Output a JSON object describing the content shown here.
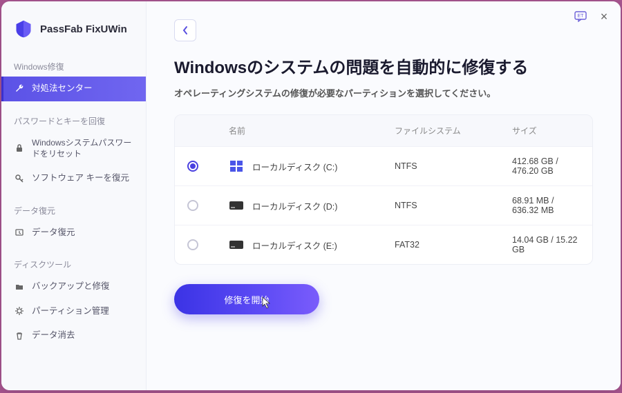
{
  "app": {
    "name": "PassFab FixUWin"
  },
  "sidebar": {
    "sections": [
      {
        "heading": "Windows修復",
        "items": [
          {
            "label": "対処法センター",
            "icon": "wrench",
            "active": true
          }
        ]
      },
      {
        "heading": "パスワードとキーを回復",
        "items": [
          {
            "label": "Windowsシステムパスワードをリセット",
            "icon": "lock"
          },
          {
            "label": "ソフトウェア キーを復元",
            "icon": "key"
          }
        ]
      },
      {
        "heading": "データ復元",
        "items": [
          {
            "label": "データ復元",
            "icon": "restore"
          }
        ]
      },
      {
        "heading": "ディスクツール",
        "items": [
          {
            "label": "バックアップと修復",
            "icon": "folder"
          },
          {
            "label": "パーティション管理",
            "icon": "gear"
          },
          {
            "label": "データ消去",
            "icon": "trash"
          }
        ]
      }
    ]
  },
  "main": {
    "title": "Windowsのシステムの問題を自動的に修復する",
    "subtitle": "オペレーティングシステムの修復が必要なパーティションを選択してください。",
    "columns": {
      "name": "名前",
      "fs": "ファイルシステム",
      "size": "サイズ"
    },
    "disks": [
      {
        "selected": true,
        "icon": "windows",
        "name": "ローカルディスク (C:)",
        "fs": "NTFS",
        "size": "412.68 GB / 476.20 GB"
      },
      {
        "selected": false,
        "icon": "drive",
        "name": "ローカルディスク (D:)",
        "fs": "NTFS",
        "size": "68.91 MB / 636.32 MB"
      },
      {
        "selected": false,
        "icon": "drive",
        "name": "ローカルディスク (E:)",
        "fs": "FAT32",
        "size": "14.04 GB / 15.22 GB"
      }
    ],
    "start_button": "修復を開始"
  }
}
